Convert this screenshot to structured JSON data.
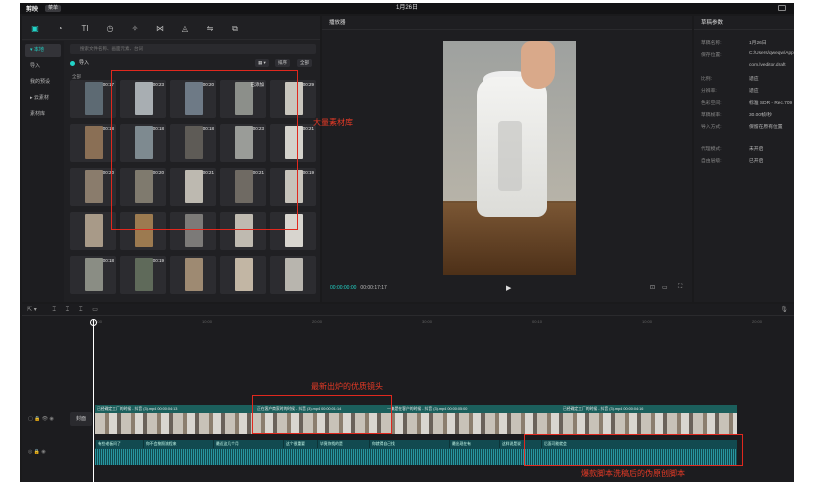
{
  "app": {
    "name": "剪映",
    "menu": "菜单",
    "project_title": "1月26日"
  },
  "toolbar": [
    {
      "icon": "media-icon",
      "glyph": "▣",
      "label": "媒体",
      "active": true
    },
    {
      "icon": "audio-icon",
      "glyph": "◔",
      "label": "音频"
    },
    {
      "icon": "text-icon",
      "glyph": "TI",
      "label": "文本"
    },
    {
      "icon": "sticker-icon",
      "glyph": "◷",
      "label": "贴纸"
    },
    {
      "icon": "effects-icon",
      "glyph": "✧",
      "label": "特效"
    },
    {
      "icon": "transition-icon",
      "glyph": "⋈",
      "label": "转场"
    },
    {
      "icon": "filter-icon",
      "glyph": "◬",
      "label": "滤镜"
    },
    {
      "icon": "adjust-icon",
      "glyph": "⇋",
      "label": "调节"
    },
    {
      "icon": "template-icon",
      "glyph": "⧉",
      "label": "模板"
    }
  ],
  "sidebar": [
    {
      "label": "▾ 本地",
      "active": true
    },
    {
      "label": "导入"
    },
    {
      "label": "我的预设"
    },
    {
      "label": "▸ 云素材"
    },
    {
      "label": "素材库"
    }
  ],
  "media": {
    "search_placeholder": "搜索文件名称、画面元素、台词",
    "import_label": "导入",
    "sort_label": "排序",
    "filter_label": "全部",
    "all_label": "全部",
    "thumbs": [
      {
        "dur": "00:17",
        "c": "#5d6a73"
      },
      {
        "dur": "00:23",
        "c": "#a8aeb2"
      },
      {
        "dur": "00:20",
        "c": "#6e7a86"
      },
      {
        "dur": "已添加",
        "c": "#8c8f8a"
      },
      {
        "dur": "00:29",
        "c": "#c9c6be"
      },
      {
        "dur": "00:18",
        "c": "#8a6f55"
      },
      {
        "dur": "00:18",
        "c": "#7e8a90"
      },
      {
        "dur": "00:18",
        "c": "#5e5b56"
      },
      {
        "dur": "00:23",
        "c": "#9a9c98"
      },
      {
        "dur": "00:21",
        "c": "#d4d2cc"
      },
      {
        "dur": "00:20",
        "c": "#8a7c6c"
      },
      {
        "dur": "00:20",
        "c": "#7f7a6e"
      },
      {
        "dur": "00:21",
        "c": "#bdb9b0"
      },
      {
        "dur": "00:21",
        "c": "#6f6a63"
      },
      {
        "dur": "00:19",
        "c": "#c7c3bb"
      },
      {
        "dur": "",
        "c": "#a89a88"
      },
      {
        "dur": "",
        "c": "#9c7a50"
      },
      {
        "dur": "",
        "c": "#7c7a78"
      },
      {
        "dur": "",
        "c": "#bfbab0"
      },
      {
        "dur": "",
        "c": "#d8d5cf"
      },
      {
        "dur": "00:18",
        "c": "#8a8d84"
      },
      {
        "dur": "00:19",
        "c": "#5f6a5a"
      },
      {
        "dur": "",
        "c": "#9e8a72"
      },
      {
        "dur": "",
        "c": "#c2b6a4"
      },
      {
        "dur": "",
        "c": "#b8b5ae"
      }
    ]
  },
  "player": {
    "title": "播放器",
    "current_time": "00:00:00:00",
    "total_time": "00:00:17:17"
  },
  "props": {
    "title": "草稿参数",
    "rows": [
      {
        "k": "草稿名称:",
        "v": "1月26日"
      },
      {
        "k": "保存位置:",
        "v": "C:/Users/qweqw/AppData/..."
      },
      {
        "k": "",
        "v": "com.lveditor.draft"
      },
      {
        "k": "比例:",
        "v": "适应"
      },
      {
        "k": "分辨率:",
        "v": "适应"
      },
      {
        "k": "色彩空间:",
        "v": "标准 SDR - Rec.709"
      },
      {
        "k": "草稿帧率:",
        "v": "30.00帧/秒"
      },
      {
        "k": "导入方式:",
        "v": "保留在原有位置"
      },
      {
        "k": "代理模式:",
        "v": "未开启"
      },
      {
        "k": "自由层级:",
        "v": "已开启"
      }
    ]
  },
  "timeline": {
    "ruler": [
      "00:00",
      "10:00",
      "20:00",
      "30:00",
      "00:10",
      "10:00",
      "20:00"
    ],
    "cover_label": "封面",
    "video_clips": [
      {
        "label": "已经确定工厂的时候 - 抖音 (3).mp4  00:00:04:13",
        "w": 160
      },
      {
        "label": "正在客户商家时的时候 - 抖音 (3).mp4  00:00:01:14",
        "w": 130
      },
      {
        "label": "一集是在客户的时候 - 抖音 (3).mp4  00:00:05:00",
        "w": 176
      },
      {
        "label": "已经确定工厂的时候 - 抖音 (3).mp4  00:00:04:16",
        "w": 176
      }
    ],
    "audio_clips": [
      {
        "label": "有些老板问了",
        "w": 48
      },
      {
        "label": "你不会按照流程来",
        "w": 70
      },
      {
        "label": "最近这几个月",
        "w": 70
      },
      {
        "label": "这个很重要",
        "w": 34
      },
      {
        "label": "毕竟你找的是",
        "w": 52
      },
      {
        "label": "你就得自己找",
        "w": 80
      },
      {
        "label": "最出现在有",
        "w": 50
      },
      {
        "label": "这样说是说",
        "w": 42
      },
      {
        "label": "后面可能就会",
        "w": 196
      }
    ]
  },
  "annotations": {
    "library": "大量素材库",
    "fresh": "最新出炉的优质镜头",
    "script": "爆款脚本洗稿后的伪原创脚本"
  }
}
